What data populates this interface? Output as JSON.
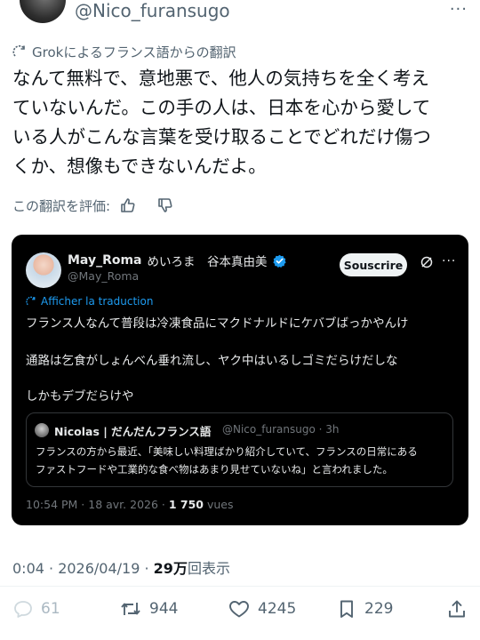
{
  "header": {
    "handle": "@Nico_furansugo",
    "more": "···"
  },
  "translation": {
    "label": "Grokによるフランス語からの翻訳",
    "lines": [
      "なんて無料で、意地悪で、他人の気持ちを全く考え",
      "ていないんだ。この手の人は、日本を心から愛して",
      "いる人がこんな言葉を受け取ることでどれだけ傷つ",
      "くか、想像もできないんだよ。"
    ],
    "rate_label": "この翻訳を評価:"
  },
  "embedded": {
    "name": "May_Roma",
    "name_jp": "めいろま　谷本真由美",
    "handle": "@May_Roma",
    "subscribe": "Souscrire",
    "more": "···",
    "translate": "Afficher la traduction",
    "lines": [
      "フランス人なんて普段は冷凍食品にマクドナルドにケバブばっかやんけ",
      "通路は乞食がしょんべん垂れ流し、ヤク中はいるしゴミだらけだしな",
      "しかもデブだらけや"
    ],
    "quote": {
      "name": "Nicolas | だんだんフランス語",
      "meta": "@Nico_furansugo · 3h",
      "lines": [
        "フランスの方から最近、「美味しい料理ばかり紹介していて、フランスの日常にある",
        "ファストフードや工業的な食べ物はあまり見せていないね」と言われました。"
      ]
    },
    "footer_time": "10:54 PM · 18 avr. 2026 · ",
    "footer_views": "1 750",
    "footer_views_label": " vues"
  },
  "meta": {
    "time": "0:04 · 2026/04/19 · ",
    "views": "29万",
    "views_label": "回表示"
  },
  "actions": {
    "replies": "61",
    "reposts": "944",
    "likes": "4245",
    "bookmarks": "229"
  },
  "colors": {
    "verified": "#1d9bf0",
    "link": "#1d9bf0",
    "muted": "#536471",
    "card_bg": "#000000"
  },
  "icons": [
    "grok-icon",
    "thumbs-up-icon",
    "thumbs-down-icon",
    "verified-badge-icon",
    "reply-icon",
    "repost-icon",
    "like-icon",
    "bookmark-icon",
    "share-icon"
  ]
}
